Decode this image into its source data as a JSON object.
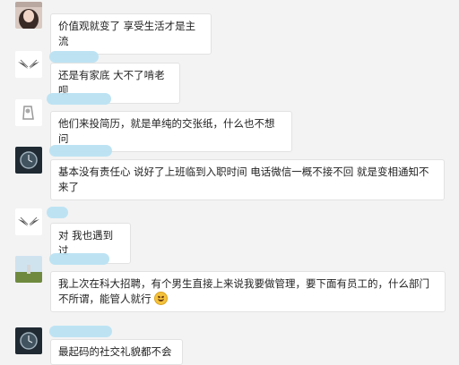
{
  "colors": {
    "background": "#f3f3f3",
    "bubble": "#ffffff",
    "name_blur": "#b9e1f2"
  },
  "messages": [
    {
      "avatar": "photo-girl-avatar",
      "text": "价值观就变了 享受生活才是主流"
    },
    {
      "avatar": "wings-logo-avatar",
      "text": "还是有家底 大不了啃老呗"
    },
    {
      "avatar": "sketch-avatar",
      "text": "他们来投简历，就是单纯的交张纸，什么也不想问"
    },
    {
      "avatar": "watch-avatar",
      "text": "基本没有责任心 说好了上班临到入职时间 电话微信一概不接不回 就是变相通知不来了"
    },
    {
      "avatar": "wings-logo-avatar",
      "text": "对 我也遇到过"
    },
    {
      "avatar": "landscape-avatar",
      "text": "我上次在科大招聘，有个男生直接上来说我要做管理，要下面有员工的，什么部门不所谓，能管人就行",
      "emoji": "grin-emoji"
    },
    {
      "avatar": "watch-avatar",
      "text": "最起码的社交礼貌都不会"
    }
  ]
}
